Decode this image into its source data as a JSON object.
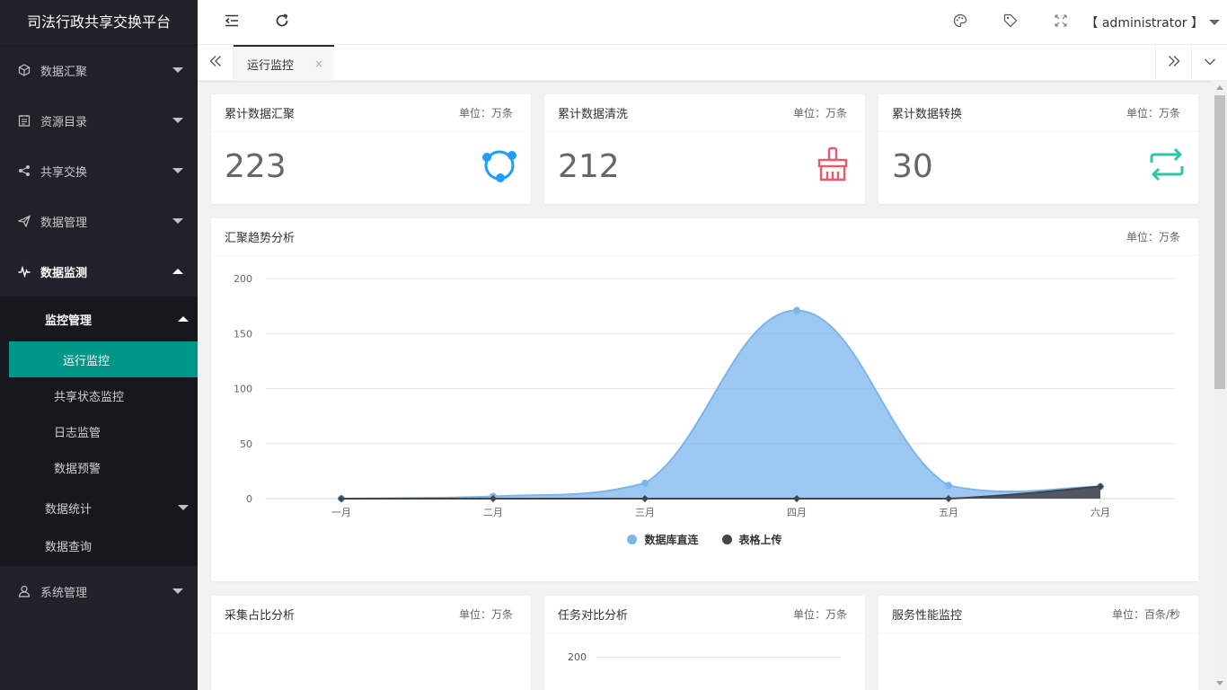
{
  "app": {
    "title": "司法行政共享交换平台"
  },
  "sidebar": {
    "items": [
      {
        "label": "数据汇聚",
        "icon": "cube-icon"
      },
      {
        "label": "资源目录",
        "icon": "catalog-icon"
      },
      {
        "label": "共享交换",
        "icon": "share-icon"
      },
      {
        "label": "数据管理",
        "icon": "send-icon"
      },
      {
        "label": "数据监测",
        "icon": "pulse-icon"
      },
      {
        "label": "系统管理",
        "icon": "user-icon"
      }
    ],
    "sub": {
      "monitor_mgmt": "监控管理",
      "leaves": [
        "运行监控",
        "共享状态监控",
        "日志监管",
        "数据预警"
      ],
      "stats": "数据统计",
      "query": "数据查询"
    }
  },
  "header": {
    "user": "【 administrator 】"
  },
  "tabs": {
    "active": "运行监控",
    "close": "×"
  },
  "stats": [
    {
      "title": "累计数据汇聚",
      "unit": "单位：万条",
      "value": "223",
      "color": "#1e9fff"
    },
    {
      "title": "累计数据清洗",
      "unit": "单位：万条",
      "value": "212",
      "color": "#e8586f"
    },
    {
      "title": "累计数据转换",
      "unit": "单位：万条",
      "value": "30",
      "color": "#2ec4a6"
    }
  ],
  "trend": {
    "title": "汇聚趋势分析",
    "unit": "单位：万条"
  },
  "bottom": [
    {
      "title": "采集占比分析",
      "unit": "单位：万条"
    },
    {
      "title": "任务对比分析",
      "unit": "单位：万条",
      "ytick": "200"
    },
    {
      "title": "服务性能监控",
      "unit": "单位：百条/秒"
    }
  ],
  "chart_data": {
    "type": "area",
    "categories": [
      "一月",
      "二月",
      "三月",
      "四月",
      "五月",
      "六月"
    ],
    "yticks": [
      0,
      50,
      100,
      150,
      200
    ],
    "ylim": [
      0,
      200
    ],
    "grid": true,
    "legend_position": "bottom-center",
    "series": [
      {
        "name": "数据库直连",
        "values": [
          0,
          2,
          14,
          171,
          12,
          11
        ],
        "color": "#7cb5ec"
      },
      {
        "name": "表格上传",
        "values": [
          0,
          0,
          0,
          0,
          0,
          11
        ],
        "color": "#434348"
      }
    ]
  }
}
